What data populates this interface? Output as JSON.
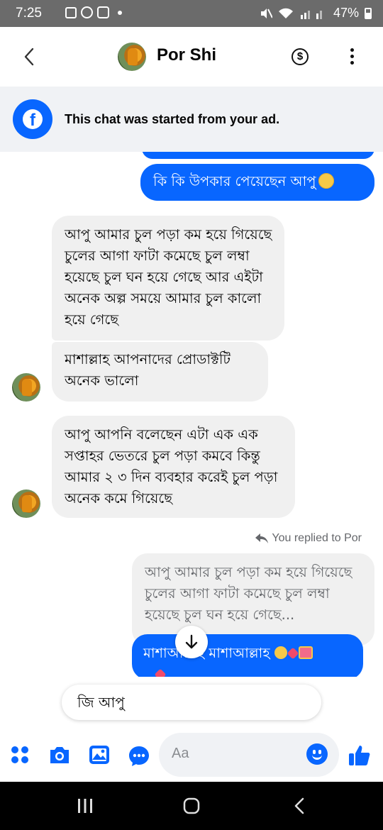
{
  "status_bar": {
    "time": "7:25",
    "battery": "47%"
  },
  "header": {
    "contact_name": "Por Shi"
  },
  "banner": {
    "text": "This chat was started from your ad."
  },
  "messages": {
    "m1": "কি কি উপকার পেয়েছেন আপু",
    "m2": "আপু আমার চুল পড়া কম হয়ে গিয়েছে চুলের আগা ফাটা কমেছে চুল লম্বা হয়েছে চুল ঘন হয়ে গেছে আর এইটা অনেক অল্প সময়ে আমার চুল কালো হয়ে গেছে",
    "m3": "মাশাল্লাহ আপনাদের প্রোডাক্টটি অনেক ভালো",
    "m4": "আপু আপনি বলেছেন এটা এক এক সপ্তাহর ভেতরে চুল পড়া কমবে কিন্তু আমার ২ ৩ দিন ব্যবহার করেই চুল পড়া অনেক কমে গিয়েছে",
    "reply_label": "You replied to Por",
    "quote": "আপু আমার চুল পড়া কম হয়ে গিয়েছে চুলের আগা ফাটা কমেছে চুল লম্বা হয়েছে চুল ঘন হয়ে গেছে...",
    "m5": "মাশাআল্লাহ মাশাআল্লাহ"
  },
  "smart_reply": "জি আপু",
  "composer": {
    "placeholder": "Aa"
  },
  "colors": {
    "accent": "#0866ff",
    "incoming_bubble": "#f0f0f0",
    "banner_bg": "#f0f2f5",
    "status_bar": "#6b6b6b"
  },
  "icons": [
    "back-icon",
    "dollar-icon",
    "more-icon",
    "facebook-icon",
    "scroll-down-icon",
    "menu-grid-icon",
    "camera-icon",
    "gallery-icon",
    "chat-bubble-icon",
    "emoji-icon",
    "like-icon",
    "recents-icon",
    "home-icon",
    "nav-back-icon"
  ]
}
